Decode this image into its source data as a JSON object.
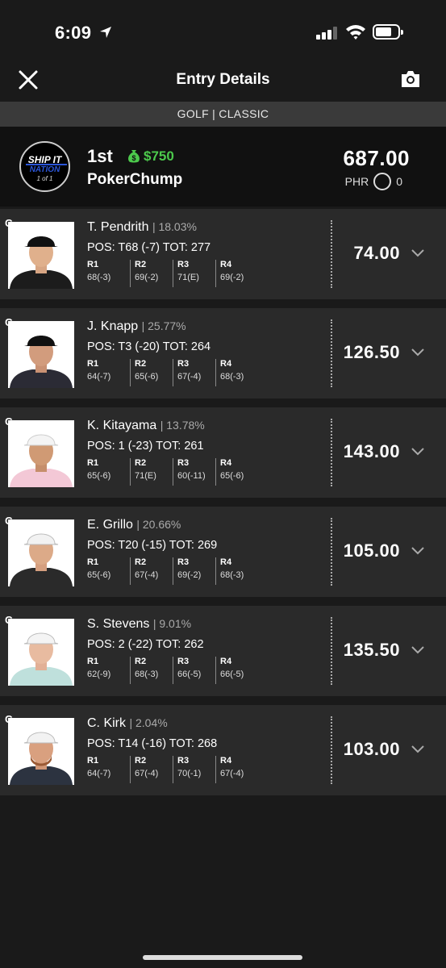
{
  "status_bar": {
    "time": "6:09"
  },
  "nav": {
    "title": "Entry Details"
  },
  "sub_header": "GOLF | CLASSIC",
  "entry": {
    "team_logo": {
      "line1": "SHIP IT",
      "line2": "NATION",
      "line3": "1 of 1"
    },
    "place": "1st",
    "winnings": "$750",
    "username": "PokerChump",
    "total_points": "687.00",
    "phr_label": "PHR",
    "phr_value": "0"
  },
  "colors": {
    "winnings_green": "#4cc94c",
    "card_bg": "#2a2a2a",
    "header_bg": "#3a3a3a"
  },
  "players": [
    {
      "pos": "G",
      "name": "T. Pendrith",
      "own": "| 18.03%",
      "line": "POS: T68 (-7) TOT: 277",
      "rounds": [
        {
          "label": "R1",
          "score": "68(-3)"
        },
        {
          "label": "R2",
          "score": "69(-2)"
        },
        {
          "label": "R3",
          "score": "71(E)"
        },
        {
          "label": "R4",
          "score": "69(-2)"
        }
      ],
      "points": "74.00"
    },
    {
      "pos": "G",
      "name": "J. Knapp",
      "own": "| 25.77%",
      "line": "POS: T3 (-20) TOT: 264",
      "rounds": [
        {
          "label": "R1",
          "score": "64(-7)"
        },
        {
          "label": "R2",
          "score": "65(-6)"
        },
        {
          "label": "R3",
          "score": "67(-4)"
        },
        {
          "label": "R4",
          "score": "68(-3)"
        }
      ],
      "points": "126.50"
    },
    {
      "pos": "G",
      "name": "K. Kitayama",
      "own": "| 13.78%",
      "line": "POS: 1 (-23) TOT: 261",
      "rounds": [
        {
          "label": "R1",
          "score": "65(-6)"
        },
        {
          "label": "R2",
          "score": "71(E)"
        },
        {
          "label": "R3",
          "score": "60(-11)"
        },
        {
          "label": "R4",
          "score": "65(-6)"
        }
      ],
      "points": "143.00"
    },
    {
      "pos": "G",
      "name": "E. Grillo",
      "own": "| 20.66%",
      "line": "POS: T20 (-15) TOT: 269",
      "rounds": [
        {
          "label": "R1",
          "score": "65(-6)"
        },
        {
          "label": "R2",
          "score": "67(-4)"
        },
        {
          "label": "R3",
          "score": "69(-2)"
        },
        {
          "label": "R4",
          "score": "68(-3)"
        }
      ],
      "points": "105.00"
    },
    {
      "pos": "G",
      "name": "S. Stevens",
      "own": "| 9.01%",
      "line": "POS: 2 (-22) TOT: 262",
      "rounds": [
        {
          "label": "R1",
          "score": "62(-9)"
        },
        {
          "label": "R2",
          "score": "68(-3)"
        },
        {
          "label": "R3",
          "score": "66(-5)"
        },
        {
          "label": "R4",
          "score": "66(-5)"
        }
      ],
      "points": "135.50"
    },
    {
      "pos": "G",
      "name": "C. Kirk",
      "own": "| 2.04%",
      "line": "POS: T14 (-16) TOT: 268",
      "rounds": [
        {
          "label": "R1",
          "score": "64(-7)"
        },
        {
          "label": "R2",
          "score": "67(-4)"
        },
        {
          "label": "R3",
          "score": "70(-1)"
        },
        {
          "label": "R4",
          "score": "67(-4)"
        }
      ],
      "points": "103.00"
    }
  ]
}
